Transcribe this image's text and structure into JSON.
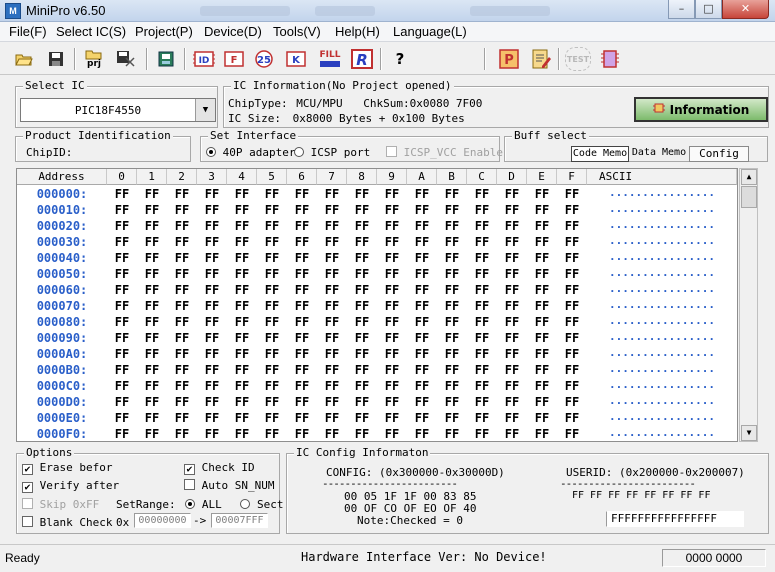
{
  "window": {
    "title": "MiniPro v6.50",
    "min": "–",
    "max": "□",
    "close": "✕"
  },
  "menu": [
    "File(F)",
    "Select IC(S)",
    "Project(P)",
    "Device(D)",
    "Tools(V)",
    "Help(H)",
    "Language(L)"
  ],
  "toolbar": {
    "prj_label": "prj",
    "fill_label": "FILL",
    "test_label": "TEST",
    "icons": [
      "open-icon",
      "save-icon",
      "open-project-icon",
      "save-project-icon",
      "chip-select-icon",
      "read-id-icon",
      "blank-check-icon",
      "read-icon",
      "verify-icon",
      "fill-icon",
      "program-icon",
      "help-icon",
      "protect-icon",
      "edit-icon",
      "test-icon",
      "chip-icon"
    ]
  },
  "select_ic": {
    "label": "Select IC",
    "value": "PIC18F4550"
  },
  "ic_info": {
    "label": "IC Information(No Project opened)",
    "chip_type_label": "ChipType:",
    "chip_type": "MCU/MPU",
    "chksum_label": "ChkSum:",
    "chksum": "0x0080 7F00",
    "size_label": "IC Size:",
    "size": "0x8000 Bytes + 0x100 Bytes"
  },
  "information_button": "Information",
  "product_id": {
    "label": "Product Identification",
    "chipid_label": "ChipID:"
  },
  "set_interface": {
    "label": "Set Interface",
    "option_40p": "40P adapter",
    "option_icsp": "ICSP port",
    "icsp_vcc": "ICSP_VCC Enable"
  },
  "buff_select": {
    "label": "Buff select",
    "code_memo": "Code Memo",
    "data_memo": "Data Memo",
    "config": "Config"
  },
  "grid": {
    "address_header": "Address",
    "columns": [
      "0",
      "1",
      "2",
      "3",
      "4",
      "5",
      "6",
      "7",
      "8",
      "9",
      "A",
      "B",
      "C",
      "D",
      "E",
      "F"
    ],
    "ascii_header": "ASCII",
    "addresses": [
      "000000:",
      "000010:",
      "000020:",
      "000030:",
      "000040:",
      "000050:",
      "000060:",
      "000070:",
      "000080:",
      "000090:",
      "0000A0:",
      "0000B0:",
      "0000C0:",
      "0000D0:",
      "0000E0:",
      "0000F0:"
    ],
    "byte_value": "FF",
    "ascii_value": "................"
  },
  "options": {
    "label": "Options",
    "erase_before": "Erase befor",
    "verify_after": "Verify after",
    "skip_0xff": "Skip 0xFF",
    "blank_check": "Blank Check",
    "check_id": "Check ID",
    "auto_sn": "Auto SN_NUM",
    "set_range": "SetRange:",
    "range_all": "ALL",
    "range_sect": "Sect",
    "range_prefix": "0x",
    "range_start": "00000000",
    "range_arrow": "->",
    "range_end": "00007FFF",
    "check_mark": "✔"
  },
  "ic_config": {
    "label": "IC Config Informaton",
    "config_title": "CONFIG: (0x300000-0x30000D)",
    "config_line1": "00 05 1F 1F 00 83 85",
    "config_line2": "00 OF CO OF EO OF 40",
    "config_note": "Note:Checked = 0",
    "userid_title": "USERID: (0x200000-0x200007)",
    "userid_line": "FF FF FF FF FF FF FF FF",
    "userid_value": "FFFFFFFFFFFFFFFF",
    "dashes": "------------------------"
  },
  "status": {
    "ready": "Ready",
    "hardware": "Hardware Interface Ver: No Device!",
    "counter": "0000 0000"
  }
}
